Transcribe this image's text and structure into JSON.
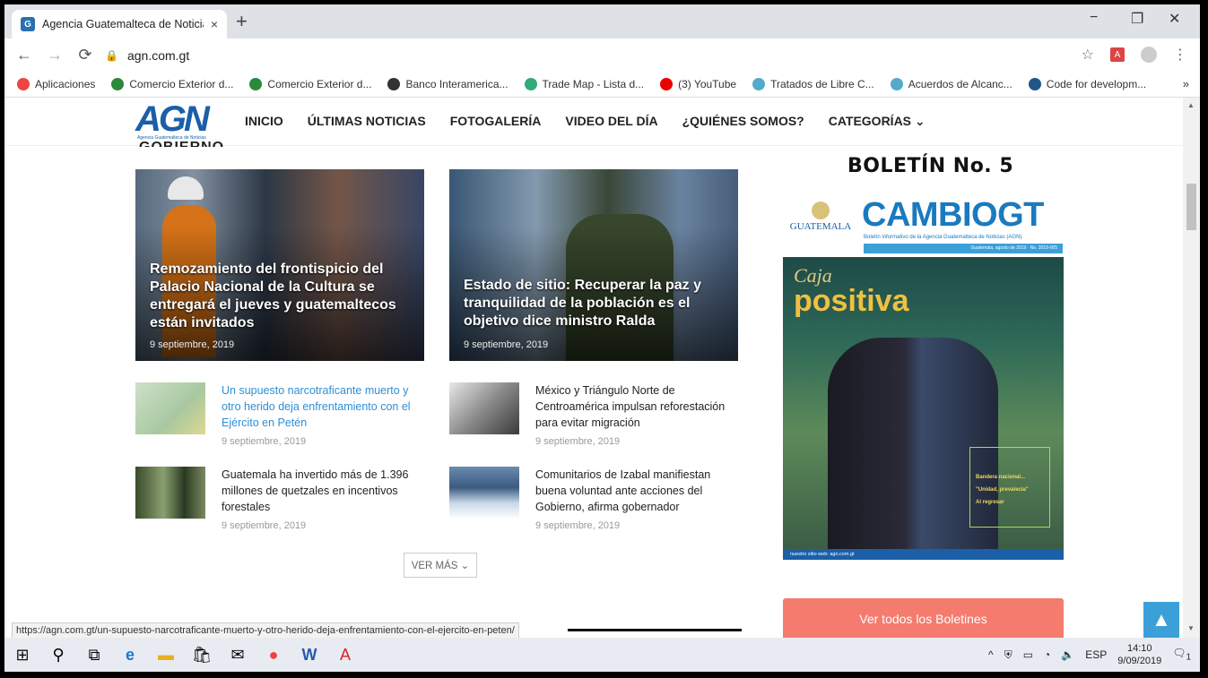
{
  "browser": {
    "tab_title": "Agencia Guatemalteca de Noticia",
    "tab_close": "×",
    "new_tab": "+",
    "url": "agn.com.gt",
    "window_minimize": "−",
    "window_restore": "❐",
    "window_close": "✕"
  },
  "bookmarks": {
    "items": [
      {
        "label": "Aplicaciones",
        "color": "#e44"
      },
      {
        "label": "Comercio Exterior d...",
        "color": "#2a8a3a"
      },
      {
        "label": "Comercio Exterior d...",
        "color": "#2a8a3a"
      },
      {
        "label": "Banco Interamerica...",
        "color": "#333"
      },
      {
        "label": "Trade Map - Lista d...",
        "color": "#3a7"
      },
      {
        "label": "(3) YouTube",
        "color": "#e00"
      },
      {
        "label": "Tratados de Libre C...",
        "color": "#5ac"
      },
      {
        "label": "Acuerdos de Alcanc...",
        "color": "#5ac"
      },
      {
        "label": "Code for developm...",
        "color": "#258"
      }
    ],
    "more": "»"
  },
  "site": {
    "logo": "AGN",
    "logo_sub": "Agencia Guatemalteca de Noticias",
    "nav": [
      "INICIO",
      "ÚLTIMAS NOTICIAS",
      "FOTOGALERÍA",
      "VIDEO DEL DÍA",
      "¿QUIÉNES SOMOS?",
      "CATEGORÍAS ⌄"
    ],
    "section_title": "GOBIERNO"
  },
  "features": [
    {
      "title": "Remozamiento del frontispicio del Palacio Nacional de la Cultura se entregará el jueves y guatemaltecos están invitados",
      "date": "9 septiembre, 2019"
    },
    {
      "title": "Estado de sitio: Recuperar la paz y tranquilidad de la población es el objetivo dice ministro Ralda",
      "date": "9 septiembre, 2019"
    }
  ],
  "articles": [
    {
      "title": "Un supuesto narcotraficante muerto y otro herido deja enfrentamiento con el Ejército en Petén",
      "date": "9 septiembre, 2019"
    },
    {
      "title": "México y Triángulo Norte de Centroamérica impulsan reforestación para evitar migración",
      "date": "9 septiembre, 2019"
    },
    {
      "title": "Guatemala ha invertido más de 1.396 millones de quetzales en incentivos forestales",
      "date": "9 septiembre, 2019"
    },
    {
      "title": "Comunitarios de Izabal manifiestan buena voluntad ante acciones del Gobierno, afirma gobernador",
      "date": "9 septiembre, 2019"
    }
  ],
  "ver_mas": "VER MÁS ⌄",
  "sidebar": {
    "bulletin_title": "BOLETÍN No. 5",
    "cover": {
      "guatemala": "GUATEMALA",
      "brand": "CAMBIOGT",
      "subtitle": "Boletín informativo de la Agencia Guatemalteca de Noticias (AGN)",
      "issue": "Guatemala, agosto de 2019 · No. 2019-005",
      "headline_1": "Caja",
      "headline_2": "positiva",
      "box_items": [
        "Bandera nacional...",
        "\"Unidad, prevalecía\"",
        "Al regresar"
      ],
      "footer": "nuestro sitio web: agn.com.gt"
    },
    "ver_boletines": "Ver todos los Boletines"
  },
  "back_to_top": "▲",
  "status_url": "https://agn.com.gt/un-supuesto-narcotraficante-muerto-y-otro-herido-deja-enfrentamiento-con-el-ejercito-en-peten/",
  "taskbar": {
    "language": "ESP",
    "time": "14:10",
    "date": "9/09/2019",
    "notifications": "1"
  }
}
